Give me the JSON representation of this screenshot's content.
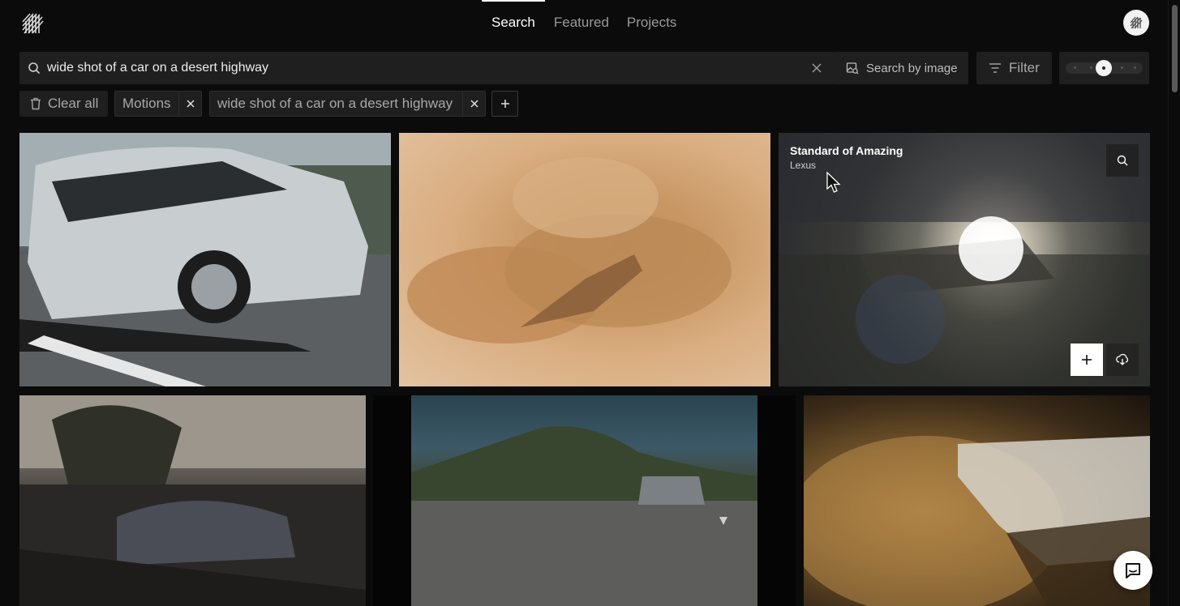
{
  "nav": {
    "tabs": [
      {
        "label": "Search",
        "active": true
      },
      {
        "label": "Featured",
        "active": false
      },
      {
        "label": "Projects",
        "active": false
      }
    ]
  },
  "search": {
    "value": "wide shot of a car on a desert highway",
    "placeholder": "",
    "search_by_image_label": "Search by image",
    "filter_label": "Filter",
    "size_slider_level": 0.5
  },
  "chips": {
    "clear_all_label": "Clear all",
    "items": [
      {
        "label": "Motions"
      },
      {
        "label": "wide shot of a car on a desert highway"
      }
    ]
  },
  "grid": {
    "hovered_tile": {
      "title": "Standard of Amazing",
      "subtitle": "Lexus"
    }
  },
  "colors": {
    "background": "#0b0b0b",
    "panel": "#1f1f1f",
    "text_primary": "#ffffff",
    "text_muted": "#a8a8a8"
  },
  "icons": [
    "logo-icon",
    "search-icon",
    "close-icon",
    "image-search-icon",
    "filter-icon",
    "trash-icon",
    "plus-icon",
    "download-icon",
    "chat-icon",
    "cursor-icon"
  ]
}
